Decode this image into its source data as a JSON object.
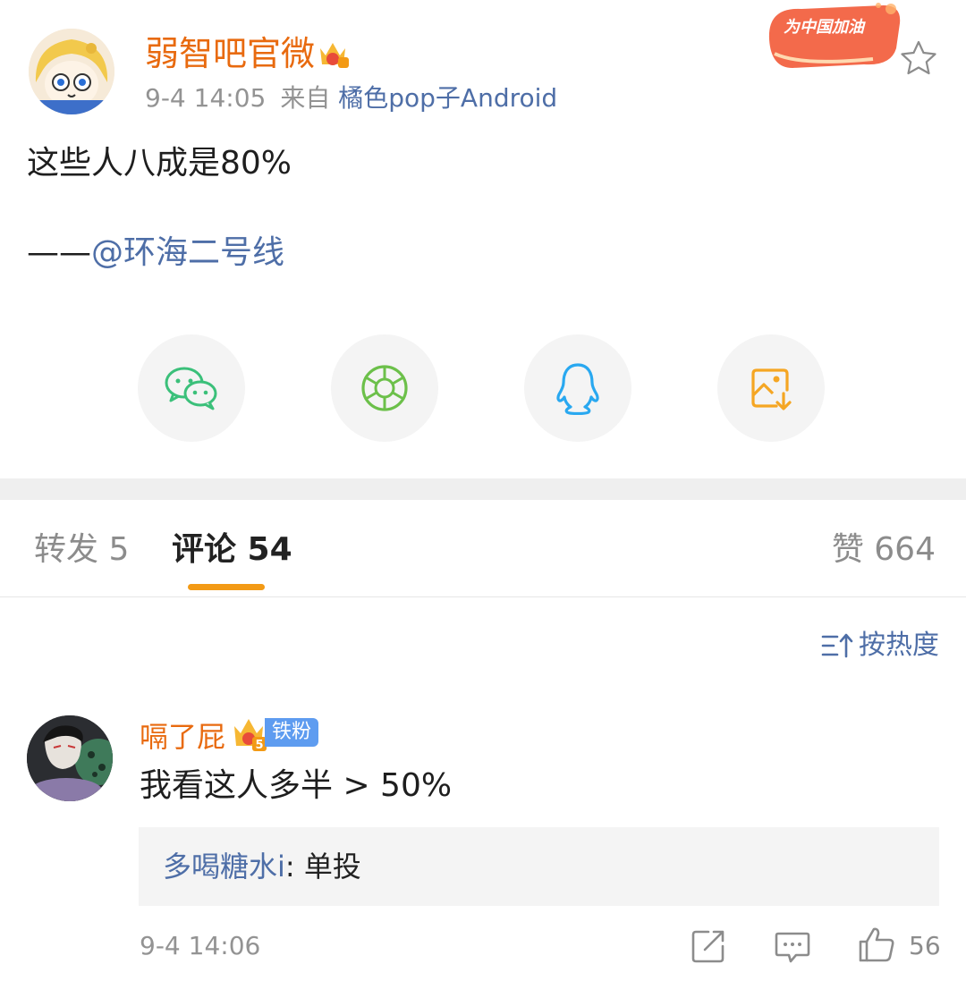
{
  "post": {
    "author": "弱智吧官微",
    "time": "9-4 14:05",
    "source_prefix": "来自",
    "source": "橘色pop子Android",
    "promo_text": "为中国加油",
    "line1": "这些人八成是80%",
    "line2_prefix": "——",
    "line2_mention": "@环海二号线"
  },
  "share": {
    "icons": [
      "wechat-icon",
      "moments-icon",
      "qq-icon",
      "save-image-icon"
    ],
    "colors": {
      "wechat": "#3bc07a",
      "moments": "#6cc04a",
      "qq": "#29a8f0",
      "save": "#f5a623"
    }
  },
  "tabs": {
    "repost": "转发 5",
    "comments": "评论 54",
    "likes": "赞 664"
  },
  "sort": {
    "label": "按热度"
  },
  "comment": {
    "user": "嗝了屁",
    "level": "5",
    "fan_badge": "铁粉",
    "text": "我看这人多半 > 50%",
    "reply_user": "多喝糖水i",
    "reply_sep": ": ",
    "reply_text": "单投",
    "time": "9-4 14:06",
    "likes": "56"
  },
  "colors": {
    "accent_orange": "#e86a0f",
    "link_blue": "#4e6ea7",
    "tab_indicator": "#f39a15"
  }
}
